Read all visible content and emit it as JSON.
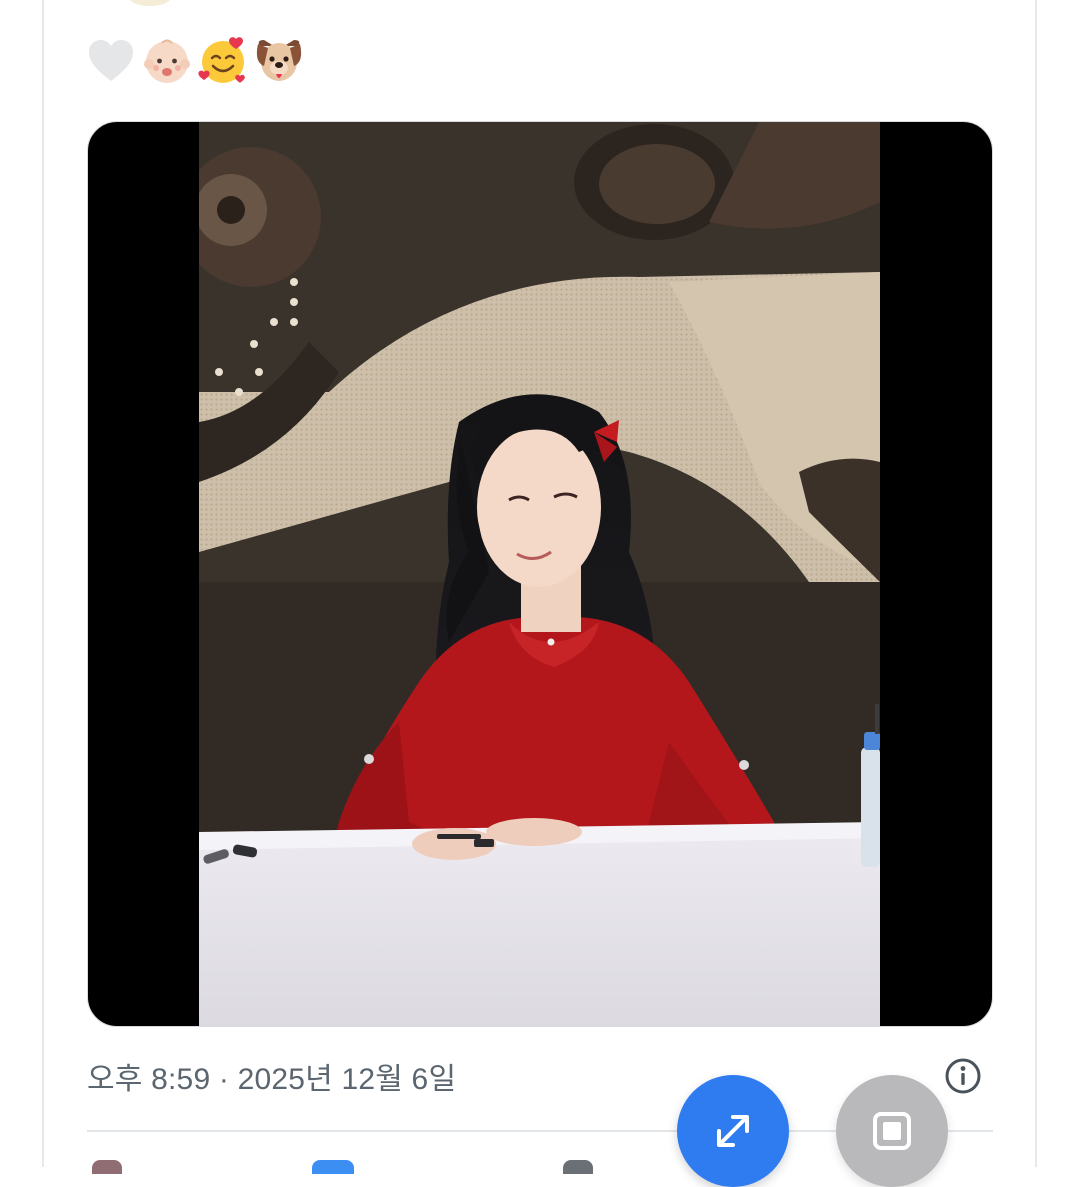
{
  "reactions": {
    "items": [
      "heart-icon",
      "baby-emoji-icon",
      "smiling-face-with-hearts-icon",
      "dog-face-icon"
    ]
  },
  "post": {
    "timestamp": "오후 8:59 · 2025년 12월 6일"
  },
  "colors": {
    "accent": "#2f7bf0",
    "timestamp_text": "#5b6670",
    "pip_button": "#b9b9bb"
  },
  "actions": {
    "expand_icon": "expand-arrows-icon",
    "pip_icon": "picture-in-picture-icon",
    "info_icon": "info-circle-icon"
  }
}
